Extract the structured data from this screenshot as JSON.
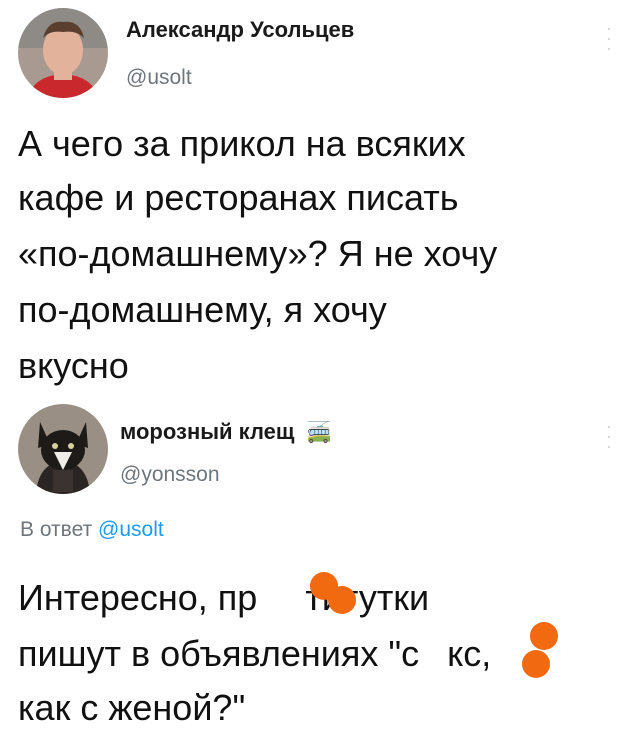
{
  "tweet1": {
    "author_name": "Александр Усольцев",
    "author_handle": "@usolt",
    "avatar_icon": "user-photo-avatar",
    "lines": [
      "А чего за прикол на всяких",
      "кафе и ресторанах писать",
      "«по-домашнему»? Я не хочу",
      "по-домашнему, я хочу",
      "вкусно"
    ]
  },
  "tweet2": {
    "author_name": "морозный клещ",
    "name_emoji": "🚎",
    "author_handle": "@yonsson",
    "avatar_icon": "cat-avatar",
    "reply_prefix": "В ответ",
    "reply_mention": "@usolt",
    "lines": [
      "Интересно, пр",
      "титутки",
      "пишут в объявлениях \"с",
      "кс,",
      "как с женой?\""
    ]
  },
  "colors": {
    "censor_blob": "#f26a0f",
    "mention": "#1d9bf0",
    "secondary_text": "#6e767d"
  }
}
